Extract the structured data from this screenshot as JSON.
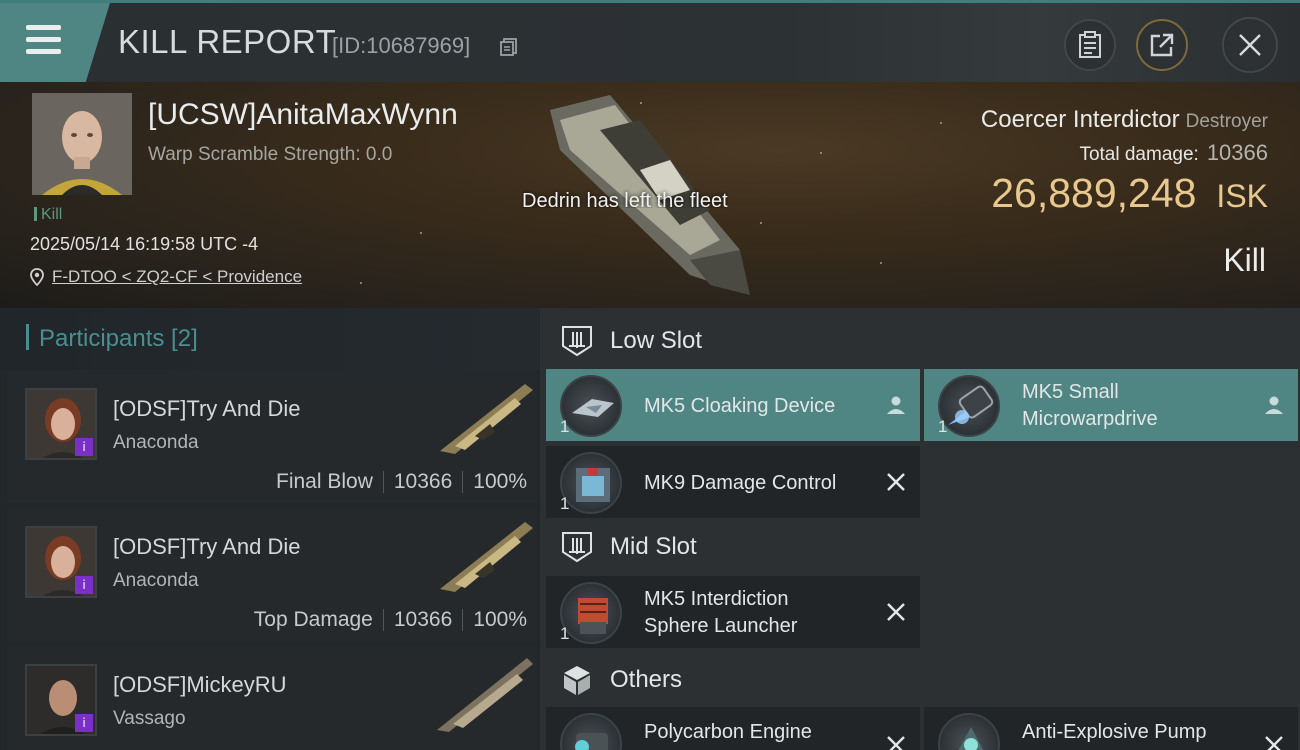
{
  "header": {
    "title": "KILL REPORT",
    "report_id": "[ID:10687969]"
  },
  "victim": {
    "name": "[UCSW]AnitaMaxWynn",
    "warp_scramble": "Warp Scramble Strength: 0.0",
    "tag": "Kill",
    "timestamp": "2025/05/14 16:19:58 UTC -4",
    "location": "F-DTOO < ZQ2-CF < Providence",
    "ship": "Coercer Interdictor",
    "ship_class": "Destroyer",
    "total_damage_label": "Total damage:",
    "total_damage": "10366",
    "isk_value": "26,889,248",
    "isk_unit": "ISK",
    "result": "Kill"
  },
  "toast": "Dedrin has left the fleet",
  "participants": {
    "title": "Participants [2]",
    "items": [
      {
        "name": "[ODSF]Try And Die",
        "ship": "Anaconda",
        "role": "Final Blow",
        "damage": "10366",
        "percent": "100%"
      },
      {
        "name": "[ODSF]Try And Die",
        "ship": "Anaconda",
        "role": "Top Damage",
        "damage": "10366",
        "percent": "100%"
      },
      {
        "name": "[ODSF]MickeyRU",
        "ship": "Vassago",
        "role": "",
        "damage": "",
        "percent": ""
      }
    ]
  },
  "fitting": {
    "low_slot": {
      "title": "Low Slot",
      "modules": [
        {
          "name": "MK5 Cloaking Device",
          "qty": "1",
          "status": "dropped"
        },
        {
          "name": "MK5 Small Microwarpdrive",
          "line1": "MK5 Small",
          "line2": "Microwarpdrive",
          "qty": "1",
          "status": "dropped"
        },
        {
          "name": "MK9 Damage Control",
          "qty": "1",
          "status": "destroyed"
        }
      ]
    },
    "mid_slot": {
      "title": "Mid Slot",
      "modules": [
        {
          "name": "MK5 Interdiction Sphere Launcher",
          "line1": "MK5 Interdiction",
          "line2": "Sphere Launcher",
          "qty": "1",
          "status": "destroyed"
        }
      ]
    },
    "others": {
      "title": "Others",
      "modules": [
        {
          "name": "Polycarbon Engine",
          "status": "destroyed"
        },
        {
          "name": "Anti-Explosive Pump",
          "status": "destroyed"
        }
      ]
    }
  },
  "colors": {
    "accent": "#4f8683",
    "isk": "#e8c88e",
    "participants_title": "#4a8f90",
    "badge": "#7a2fc9"
  },
  "icons": {
    "menu": "hamburger-menu-icon",
    "copy": "copy-icon",
    "clipboard": "clipboard-icon",
    "share": "share-icon",
    "close": "close-icon",
    "location": "location-pin-icon",
    "slot": "slot-icon",
    "others": "cube-icon",
    "dropped": "person-icon",
    "destroyed": "cross-icon"
  }
}
